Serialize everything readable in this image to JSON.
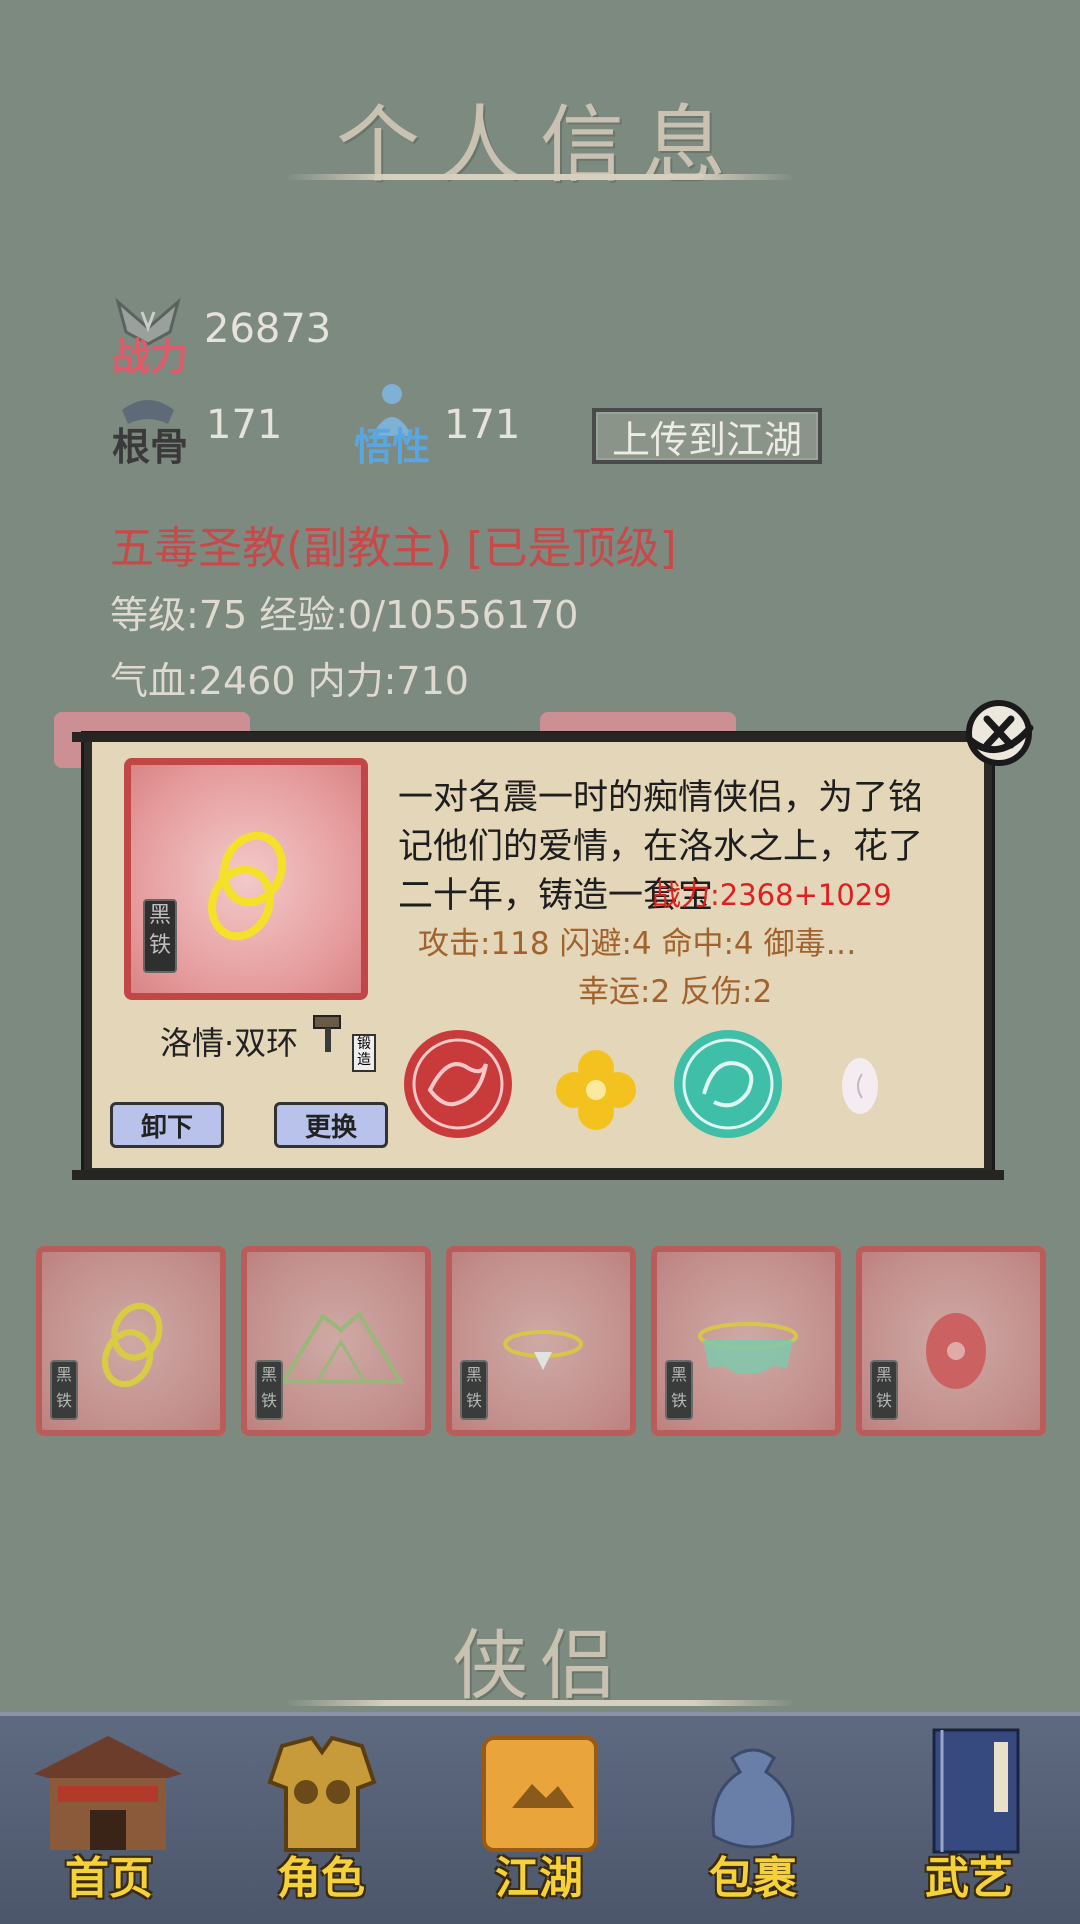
{
  "header": {
    "title": "个人信息"
  },
  "stats": {
    "power_label": "战力",
    "power_value": "26873",
    "bone_label": "根骨",
    "bone_value": "171",
    "insight_label": "悟性",
    "insight_value": "171",
    "upload_button": "上传到江湖"
  },
  "profile": {
    "sect": "五毒圣教(副教主) [已是顶级]",
    "level_exp": "等级:75 经验:0/10556170",
    "hp_mp": "气血:2460 内力:710"
  },
  "popup": {
    "item_grade": "黑铁",
    "item_name": "洛情·双环",
    "forge_tag": "锻造",
    "unequip_button": "卸下",
    "replace_button": "更换",
    "description": "一对名震一时的痴情侠侣，为了铭记他们的爱情，在洛水之上，花了二十年，铸造一套宝",
    "power_overlay": "战力:2368+1029",
    "stats_line1": "攻击:118   闪避:4   命中:4   御毒…",
    "stats_line2": "幸运:2   反伤:2"
  },
  "equipment_slots": [
    {
      "icon": "ring-icon",
      "grade": "黑铁"
    },
    {
      "icon": "mountain-armor-icon",
      "grade": "黑铁"
    },
    {
      "icon": "gem-ring-icon",
      "grade": "黑铁"
    },
    {
      "icon": "necklace-icon",
      "grade": "黑铁"
    },
    {
      "icon": "flower-token-icon",
      "grade": "黑铁"
    }
  ],
  "section2": {
    "title": "侠侣"
  },
  "nav": [
    {
      "label": "首页",
      "icon": "house-icon"
    },
    {
      "label": "角色",
      "icon": "armor-icon"
    },
    {
      "label": "江湖",
      "icon": "scroll-map-icon"
    },
    {
      "label": "包裹",
      "icon": "bag-icon"
    },
    {
      "label": "武艺",
      "icon": "book-icon"
    }
  ],
  "colors": {
    "background": "#7d8a80",
    "accent_red": "#c84949",
    "nav_text": "#f5d23a"
  }
}
